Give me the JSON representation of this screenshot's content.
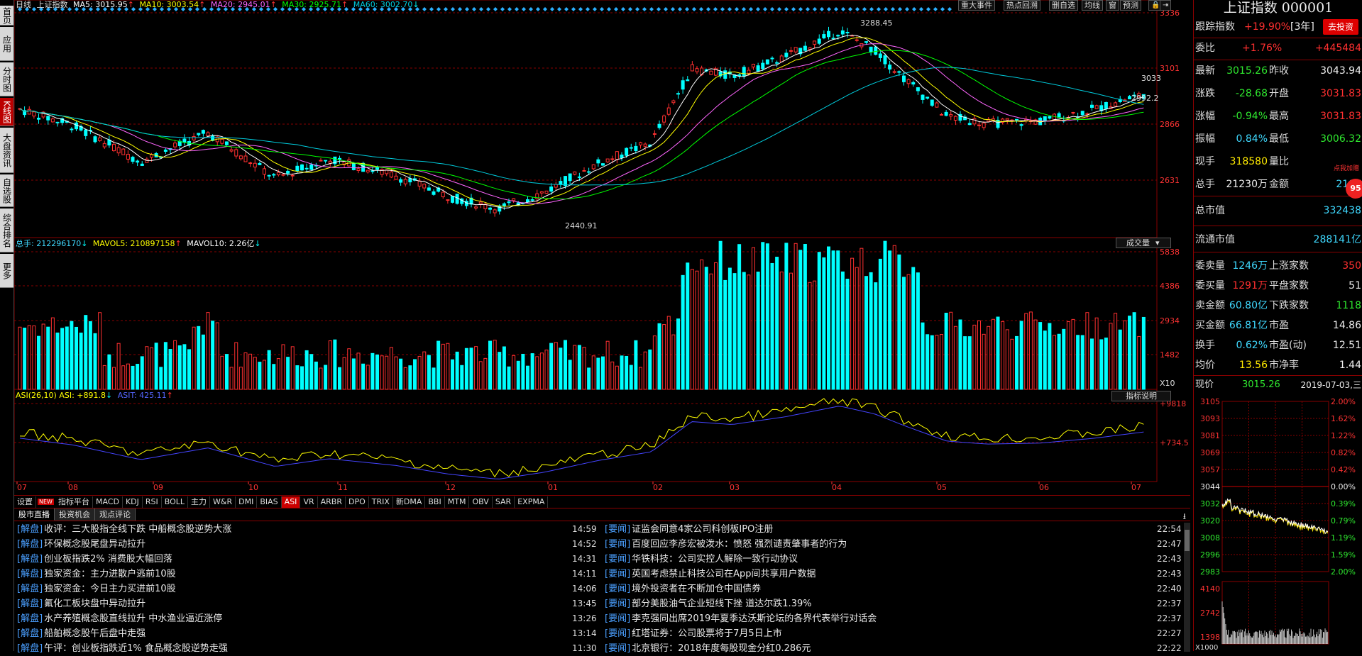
{
  "nav": [
    {
      "label": "首页",
      "active": false
    },
    {
      "label": "应用",
      "active": false
    },
    {
      "label": "分时图",
      "active": false
    },
    {
      "label": "K线图",
      "active": true
    },
    {
      "label": "大盘资讯",
      "active": false
    },
    {
      "label": "自选股",
      "active": false
    },
    {
      "label": "综合排名",
      "active": false
    },
    {
      "label": "更多",
      "active": false
    }
  ],
  "main": {
    "period": "日线",
    "index_name": "上证指数",
    "ma5": "MA5: 3015.95",
    "ma10": "MA10: 3003.54",
    "ma20": "MA20: 2945.01",
    "ma30": "MA30: 2925.71",
    "ma60": "MA60: 3002.70",
    "high_label": "3288.45",
    "low_label": "2440.91",
    "price_label_a": "3033",
    "price_label_b": "2992.2",
    "price_axis": [
      "3336",
      "3101",
      "2866",
      "2631"
    ]
  },
  "toolbar": [
    "重大事件",
    "热点回溯",
    "删自选",
    "均线",
    "窗",
    "预测"
  ],
  "volume": {
    "total": "总手: 212296170",
    "mavol5": "MAVOL5: 210897158",
    "mavol10": "MAVOL10: 2.26亿",
    "dropdown": "成交量",
    "axis": [
      "5838",
      "4386",
      "2934",
      "1482"
    ],
    "unit": "X10"
  },
  "asi": {
    "asi": "ASI(26,10) ASI: +891.8",
    "asit": "ASIT: 425.11",
    "button": "指标说明",
    "axis": [
      "+9818",
      "+734.5"
    ]
  },
  "months": [
    "07",
    "08",
    "09",
    "10",
    "11",
    "12",
    "01",
    "02",
    "03",
    "04",
    "05",
    "06",
    "07"
  ],
  "indicator_tabs": [
    "设置",
    "指标平台",
    "MACD",
    "KDJ",
    "RSI",
    "BOLL",
    "主力",
    "W&R",
    "DMI",
    "BIAS",
    "ASI",
    "VR",
    "ARBR",
    "DPO",
    "TRIX",
    "新DMA",
    "BBI",
    "MTM",
    "OBV",
    "SAR",
    "EXPMA"
  ],
  "indicator_active": "ASI",
  "new_badge": "NEW",
  "news_tabs": [
    "股市直播",
    "投资机会",
    "观点评论"
  ],
  "news_left": [
    {
      "tag": "[解盘]",
      "title": "收评：三大股指全线下跌 中船概念股逆势大涨",
      "time": "14:59"
    },
    {
      "tag": "[解盘]",
      "title": "环保概念股尾盘异动拉升",
      "time": "14:52"
    },
    {
      "tag": "[解盘]",
      "title": "创业板指跌2% 消费股大幅回落",
      "time": "14:31"
    },
    {
      "tag": "[解盘]",
      "title": "独家资金：主力进散户逃前10股",
      "time": "14:11"
    },
    {
      "tag": "[解盘]",
      "title": "独家资金：今日主力买进前10股",
      "time": "14:06"
    },
    {
      "tag": "[解盘]",
      "title": "氟化工板块盘中异动拉升",
      "time": "13:45"
    },
    {
      "tag": "[解盘]",
      "title": "水产养殖概念股直线拉升 中水渔业逼近涨停",
      "time": "13:26"
    },
    {
      "tag": "[解盘]",
      "title": "船舶概念股午后盘中走强",
      "time": "13:14"
    },
    {
      "tag": "[解盘]",
      "title": "午评：创业板指跌近1% 食品概念股逆势走强",
      "time": "11:30"
    }
  ],
  "news_right": [
    {
      "tag": "[要闻]",
      "title": "证监会同意4家公司科创板IPO注册",
      "time": "22:54"
    },
    {
      "tag": "[要闻]",
      "title": "百度回应李彦宏被泼水：愤怒 强烈谴责肇事者的行为",
      "time": "22:47"
    },
    {
      "tag": "[要闻]",
      "title": "华铁科技：公司实控人解除一致行动协议",
      "time": "22:43"
    },
    {
      "tag": "[要闻]",
      "title": "英国考虑禁止科技公司在App间共享用户数据",
      "time": "22:43"
    },
    {
      "tag": "[要闻]",
      "title": "境外投资者在不断加仓中国债券",
      "time": "22:40"
    },
    {
      "tag": "[要闻]",
      "title": "部分美股油气企业短线下挫 道达尔跌1.39%",
      "time": "22:37"
    },
    {
      "tag": "[要闻]",
      "title": "李克强同出席2019年夏季达沃斯论坛的各界代表举行对话会",
      "time": "22:37"
    },
    {
      "tag": "[要闻]",
      "title": "红塔证券：公司股票将于7月5日上市",
      "time": "22:27"
    },
    {
      "tag": "[要闻]",
      "title": "北京银行：2018年度每股现金分红0.286元",
      "time": "22:22"
    }
  ],
  "right": {
    "title": "上证指数 000001",
    "track_label": "跟踪指数",
    "track_value": "+19.90%",
    "track_period": "[3年]",
    "invest_button": "去投资",
    "webi_label": "委比",
    "webi_pct": "+1.76%",
    "webi_val": "+445484",
    "rows": [
      {
        "l1": "最新",
        "v1": "3015.26",
        "c1": "green",
        "l2": "昨收",
        "v2": "3043.94",
        "c2": "white"
      },
      {
        "l1": "涨跌",
        "v1": "-28.68",
        "c1": "green",
        "l2": "开盘",
        "v2": "3031.83",
        "c2": "red"
      },
      {
        "l1": "涨幅",
        "v1": "-0.94%",
        "c1": "green",
        "l2": "最高",
        "v2": "3031.83",
        "c2": "red"
      },
      {
        "l1": "振幅",
        "v1": "0.84%",
        "c1": "cyan",
        "l2": "最低",
        "v2": "3006.32",
        "c2": "green"
      },
      {
        "l1": "现手",
        "v1": "318580",
        "c1": "yellow",
        "l2": "量比",
        "v2": "",
        "c2": "white"
      },
      {
        "l1": "总手",
        "v1": "21230万",
        "c1": "white",
        "l2": "金额",
        "v2": "2187",
        "c2": "cyan"
      }
    ],
    "market_cap_label": "总市值",
    "market_cap": "332438",
    "float_cap_label": "流通市值",
    "float_cap": "288141亿",
    "rows2": [
      {
        "l1": "委卖量",
        "v1": "1246万",
        "c1": "cyan",
        "l2": "上涨家数",
        "v2": "350",
        "c2": "red"
      },
      {
        "l1": "委买量",
        "v1": "1291万",
        "c1": "red",
        "l2": "平盘家数",
        "v2": "51",
        "c2": "white"
      },
      {
        "l1": "卖金额",
        "v1": "60.80亿",
        "c1": "cyan",
        "l2": "下跌家数",
        "v2": "1118",
        "c2": "green"
      },
      {
        "l1": "买金额",
        "v1": "66.81亿",
        "c1": "cyan",
        "l2": "市盈",
        "v2": "14.86",
        "c2": "white"
      },
      {
        "l1": "换手",
        "v1": "0.62%",
        "c1": "cyan",
        "l2": "市盈(动)",
        "v2": "12.51",
        "c2": "white"
      },
      {
        "l1": "均价",
        "v1": "13.56",
        "c1": "yellow",
        "l2": "市净率",
        "v2": "1.44",
        "c2": "white"
      }
    ],
    "mini_label": "现价",
    "mini_price": "3015.26",
    "mini_date": "2019-07-03,三",
    "mini_left_axis": [
      "3105",
      "3093",
      "3081",
      "3069",
      "3057",
      "3044",
      "3032",
      "3020",
      "3008",
      "2996",
      "2983"
    ],
    "mini_right_axis": [
      "2.00%",
      "1.62%",
      "1.22%",
      "0.82%",
      "0.42%",
      "0.00%",
      "0.39%",
      "0.79%",
      "1.19%",
      "1.59%",
      "2.00%"
    ],
    "mini_vol_axis": [
      "4140",
      "2742",
      "1398"
    ],
    "mini_vol_unit": "X1000",
    "float_ad": "点我加赠",
    "float_ad_num": "95"
  },
  "colors": {
    "up": "#ff3030",
    "down": "#00ffff",
    "ma5": "#ffffff",
    "ma10": "#ffff00",
    "ma20": "#ff66ff",
    "ma30": "#00ff00",
    "ma60": "#00ccdd"
  }
}
